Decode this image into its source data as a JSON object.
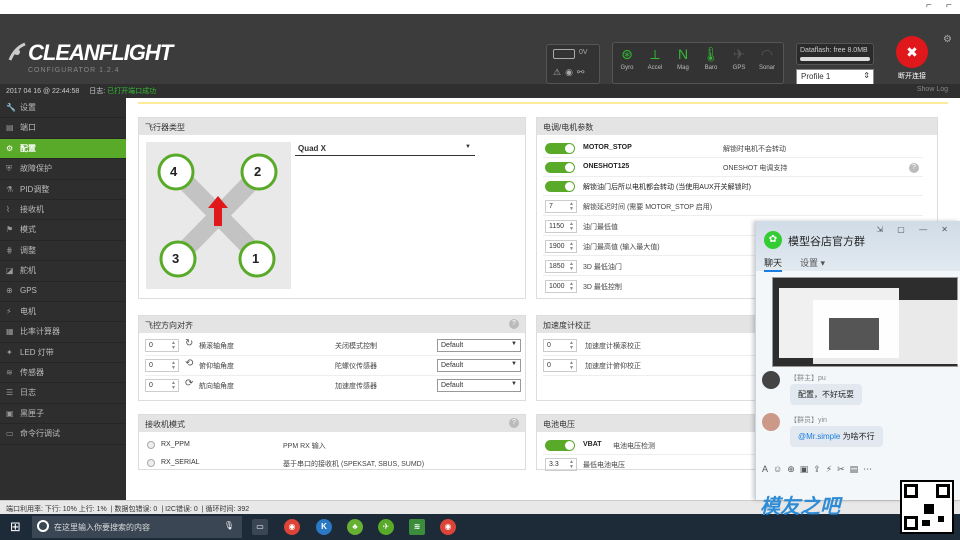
{
  "header": {
    "logo_word_a": "CLEAN",
    "logo_word_b": "FLIGHT",
    "logo_sub": "CONFIGURATOR  1.2.4",
    "battery_voltage": "0V",
    "sensors": [
      {
        "label": "Gyro",
        "icon": "gyro-icon",
        "on": true
      },
      {
        "label": "Accel",
        "icon": "accel-icon",
        "on": true
      },
      {
        "label": "Mag",
        "icon": "mag-icon",
        "on": true
      },
      {
        "label": "Baro",
        "icon": "baro-icon",
        "on": true
      },
      {
        "label": "GPS",
        "icon": "gps-icon",
        "on": false
      },
      {
        "label": "Sonar",
        "icon": "sonar-icon",
        "on": false
      }
    ],
    "dataflash": "Dataflash: free 8.0MB",
    "profile": "Profile 1",
    "disconnect": "断开连接"
  },
  "logbar": {
    "time": "2017 04 16 @ 22:44:58",
    "label": "日志:",
    "message": "已打开端口成功",
    "show_log": "Show Log"
  },
  "sidebar": {
    "items": [
      {
        "label": "设置",
        "icon": "wrench-icon"
      },
      {
        "label": "端口",
        "icon": "ports-icon"
      },
      {
        "label": "配置",
        "icon": "gear-icon",
        "active": true
      },
      {
        "label": "故障保护",
        "icon": "failsafe-icon"
      },
      {
        "label": "PID调整",
        "icon": "pid-icon"
      },
      {
        "label": "接收机",
        "icon": "receiver-icon"
      },
      {
        "label": "模式",
        "icon": "modes-icon"
      },
      {
        "label": "调整",
        "icon": "adjust-icon"
      },
      {
        "label": "舵机",
        "icon": "servo-icon"
      },
      {
        "label": "GPS",
        "icon": "gps-icon"
      },
      {
        "label": "电机",
        "icon": "motor-icon"
      },
      {
        "label": "比率计算器",
        "icon": "calc-icon"
      },
      {
        "label": "LED 灯带",
        "icon": "led-icon"
      },
      {
        "label": "传感器",
        "icon": "sensor-icon"
      },
      {
        "label": "日志",
        "icon": "log-icon"
      },
      {
        "label": "黑匣子",
        "icon": "blackbox-icon"
      },
      {
        "label": "命令行调试",
        "icon": "cli-icon"
      }
    ]
  },
  "mixer": {
    "title": "飞行器类型",
    "selected": "Quad X",
    "motors": [
      "4",
      "2",
      "3",
      "1"
    ]
  },
  "esc": {
    "title": "电调/电机参数",
    "rows": [
      {
        "label": "MOTOR_STOP",
        "desc": "解锁时电机不会转动"
      },
      {
        "label": "ONESHOT125",
        "desc": "ONESHOT 电调支持"
      },
      {
        "label": "解锁油门后所以电机都会转动 (当使用AUX开关解锁时)",
        "desc": ""
      }
    ],
    "num_rows": [
      {
        "value": "7",
        "label": "解锁延迟时间 (需要 MOTOR_STOP 启用)"
      },
      {
        "value": "1150",
        "label": "油门最低值"
      },
      {
        "value": "1900",
        "label": "油门最高值 (输入最大值)"
      },
      {
        "value": "1850",
        "label": "3D 最低油门"
      },
      {
        "value": "1000",
        "label": "3D 最低控制"
      }
    ]
  },
  "board": {
    "title": "飞控方向对齐",
    "rows": [
      {
        "value": "0",
        "label": "横滚轴角度",
        "mid": "关闭模式控制",
        "select": "Default"
      },
      {
        "value": "0",
        "label": "俯仰轴角度",
        "mid": "陀螺仪传感器",
        "select": "Default"
      },
      {
        "value": "0",
        "label": "航向轴角度",
        "mid": "加速度传感器",
        "select": "Default"
      }
    ]
  },
  "accel": {
    "title": "加速度计校正",
    "rows": [
      {
        "value": "0",
        "label": "加速度计横滚校正"
      },
      {
        "value": "0",
        "label": "加速度计俯仰校正"
      }
    ]
  },
  "receiver": {
    "title": "接收机模式",
    "rows": [
      {
        "label": "RX_PPM",
        "desc": "PPM RX 输入"
      },
      {
        "label": "RX_SERIAL",
        "desc": "基于串口的接收机 (SPEKSAT, SBUS, SUMD)"
      }
    ]
  },
  "battery": {
    "title": "电池电压",
    "row_label": "VBAT",
    "row_desc": "电池电压检测",
    "num_value": "3.3",
    "num_label": "最低电池电压"
  },
  "status": {
    "items": [
      "端口利用率: 下行: 10% 上行: 1%",
      "数据包错误: 0",
      "I2C错误: 0",
      "循环时间: 392"
    ]
  },
  "taskbar": {
    "search_placeholder": "在这里输入你要搜索的内容"
  },
  "qq": {
    "group_name": "模型谷店官方群",
    "tab_chat": "聊天",
    "tab_settings": "设置",
    "msg1_name": "【群主】pu",
    "msg1_text": "配置，不好玩耍",
    "msg2_name": "【群员】yin",
    "msg2_at": "@Mr.simple",
    "msg2_text": " 为啥不行",
    "watermark": "模友之吧"
  }
}
